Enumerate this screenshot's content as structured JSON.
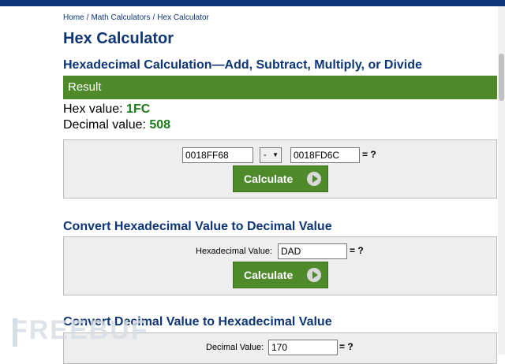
{
  "breadcrumb": {
    "home": "Home",
    "math": "Math Calculators",
    "current": "Hex Calculator",
    "separator": "/"
  },
  "page_title": "Hex Calculator",
  "calc_section": {
    "title": "Hexadecimal Calculation—Add, Subtract, Multiply, or Divide",
    "result_header": "Result",
    "hex_label": "Hex value: ",
    "hex_value": "1FC",
    "dec_label": "Decimal value: ",
    "dec_value": "508",
    "operand1": "0018FF68",
    "operator": "-",
    "operand2": "0018FD6C",
    "equals": "= ?",
    "button": "Calculate"
  },
  "hex_to_dec": {
    "title": "Convert Hexadecimal Value to Decimal Value",
    "label": "Hexadecimal Value:",
    "value": "DAD",
    "equals": "= ?",
    "button": "Calculate"
  },
  "dec_to_hex": {
    "title": "Convert Decimal Value to Hexadecimal Value",
    "label": "Decimal Value:",
    "value": "170",
    "equals": "= ?"
  },
  "watermark": "FREEBUF",
  "colors": {
    "brand_navy": "#0e3575",
    "accent_green": "#4e8a2a",
    "value_green": "#1e7a1e"
  }
}
